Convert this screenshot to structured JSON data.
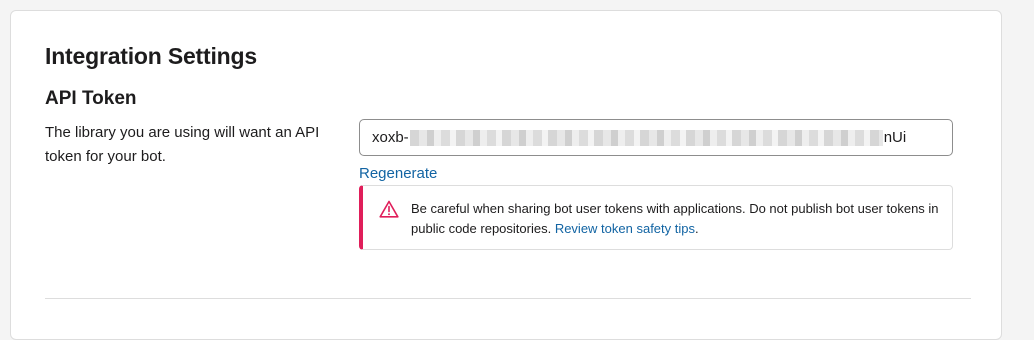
{
  "page": {
    "title": "Integration Settings"
  },
  "api_token": {
    "heading": "API Token",
    "description": "The library you are using will want an API token for your bot.",
    "token_prefix": "xoxb-",
    "token_suffix": "nUi",
    "regenerate_label": "Regenerate"
  },
  "warning": {
    "icon": "warning-triangle-icon",
    "text": "Be careful when sharing bot user tokens with applications. Do not publish bot user tokens in public code repositories. ",
    "link_label": "Review token safety tips",
    "trailing": ".",
    "accent_color": "#e01e5a"
  },
  "colors": {
    "link": "#1264a3",
    "text": "#1d1c1d",
    "border": "#dddddd"
  }
}
